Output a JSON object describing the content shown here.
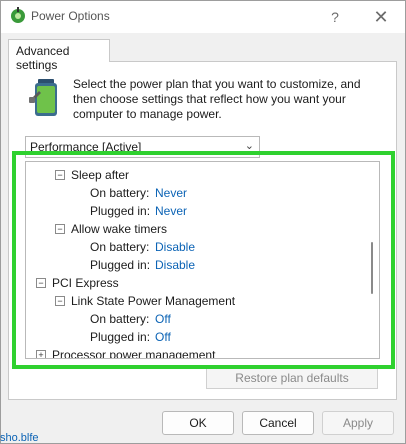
{
  "window": {
    "title": "Power Options",
    "help_glyph": "?",
    "close_glyph": "✕"
  },
  "tab": {
    "label": "Advanced settings"
  },
  "description": "Select the power plan that you want to customize, and then choose settings that reflect how you want your computer to manage power.",
  "plan_select": {
    "value": "Performance [Active]"
  },
  "tree": {
    "sleep_after": {
      "label": "Sleep after",
      "on_battery_label": "On battery:",
      "on_battery_value": "Never",
      "plugged_in_label": "Plugged in:",
      "plugged_in_value": "Never"
    },
    "allow_wake_timers": {
      "label": "Allow wake timers",
      "on_battery_label": "On battery:",
      "on_battery_value": "Disable",
      "plugged_in_label": "Plugged in:",
      "plugged_in_value": "Disable"
    },
    "pci_express": {
      "label": "PCI Express"
    },
    "link_state": {
      "label": "Link State Power Management",
      "on_battery_label": "On battery:",
      "on_battery_value": "Off",
      "plugged_in_label": "Plugged in:",
      "plugged_in_value": "Off"
    },
    "processor": {
      "label": "Processor power management"
    }
  },
  "buttons": {
    "restore": "Restore plan defaults",
    "ok": "OK",
    "cancel": "Cancel",
    "apply": "Apply"
  },
  "background_text": "sho.blfe",
  "colors": {
    "highlight": "#2fd12f",
    "value_link": "#0b63b5"
  }
}
